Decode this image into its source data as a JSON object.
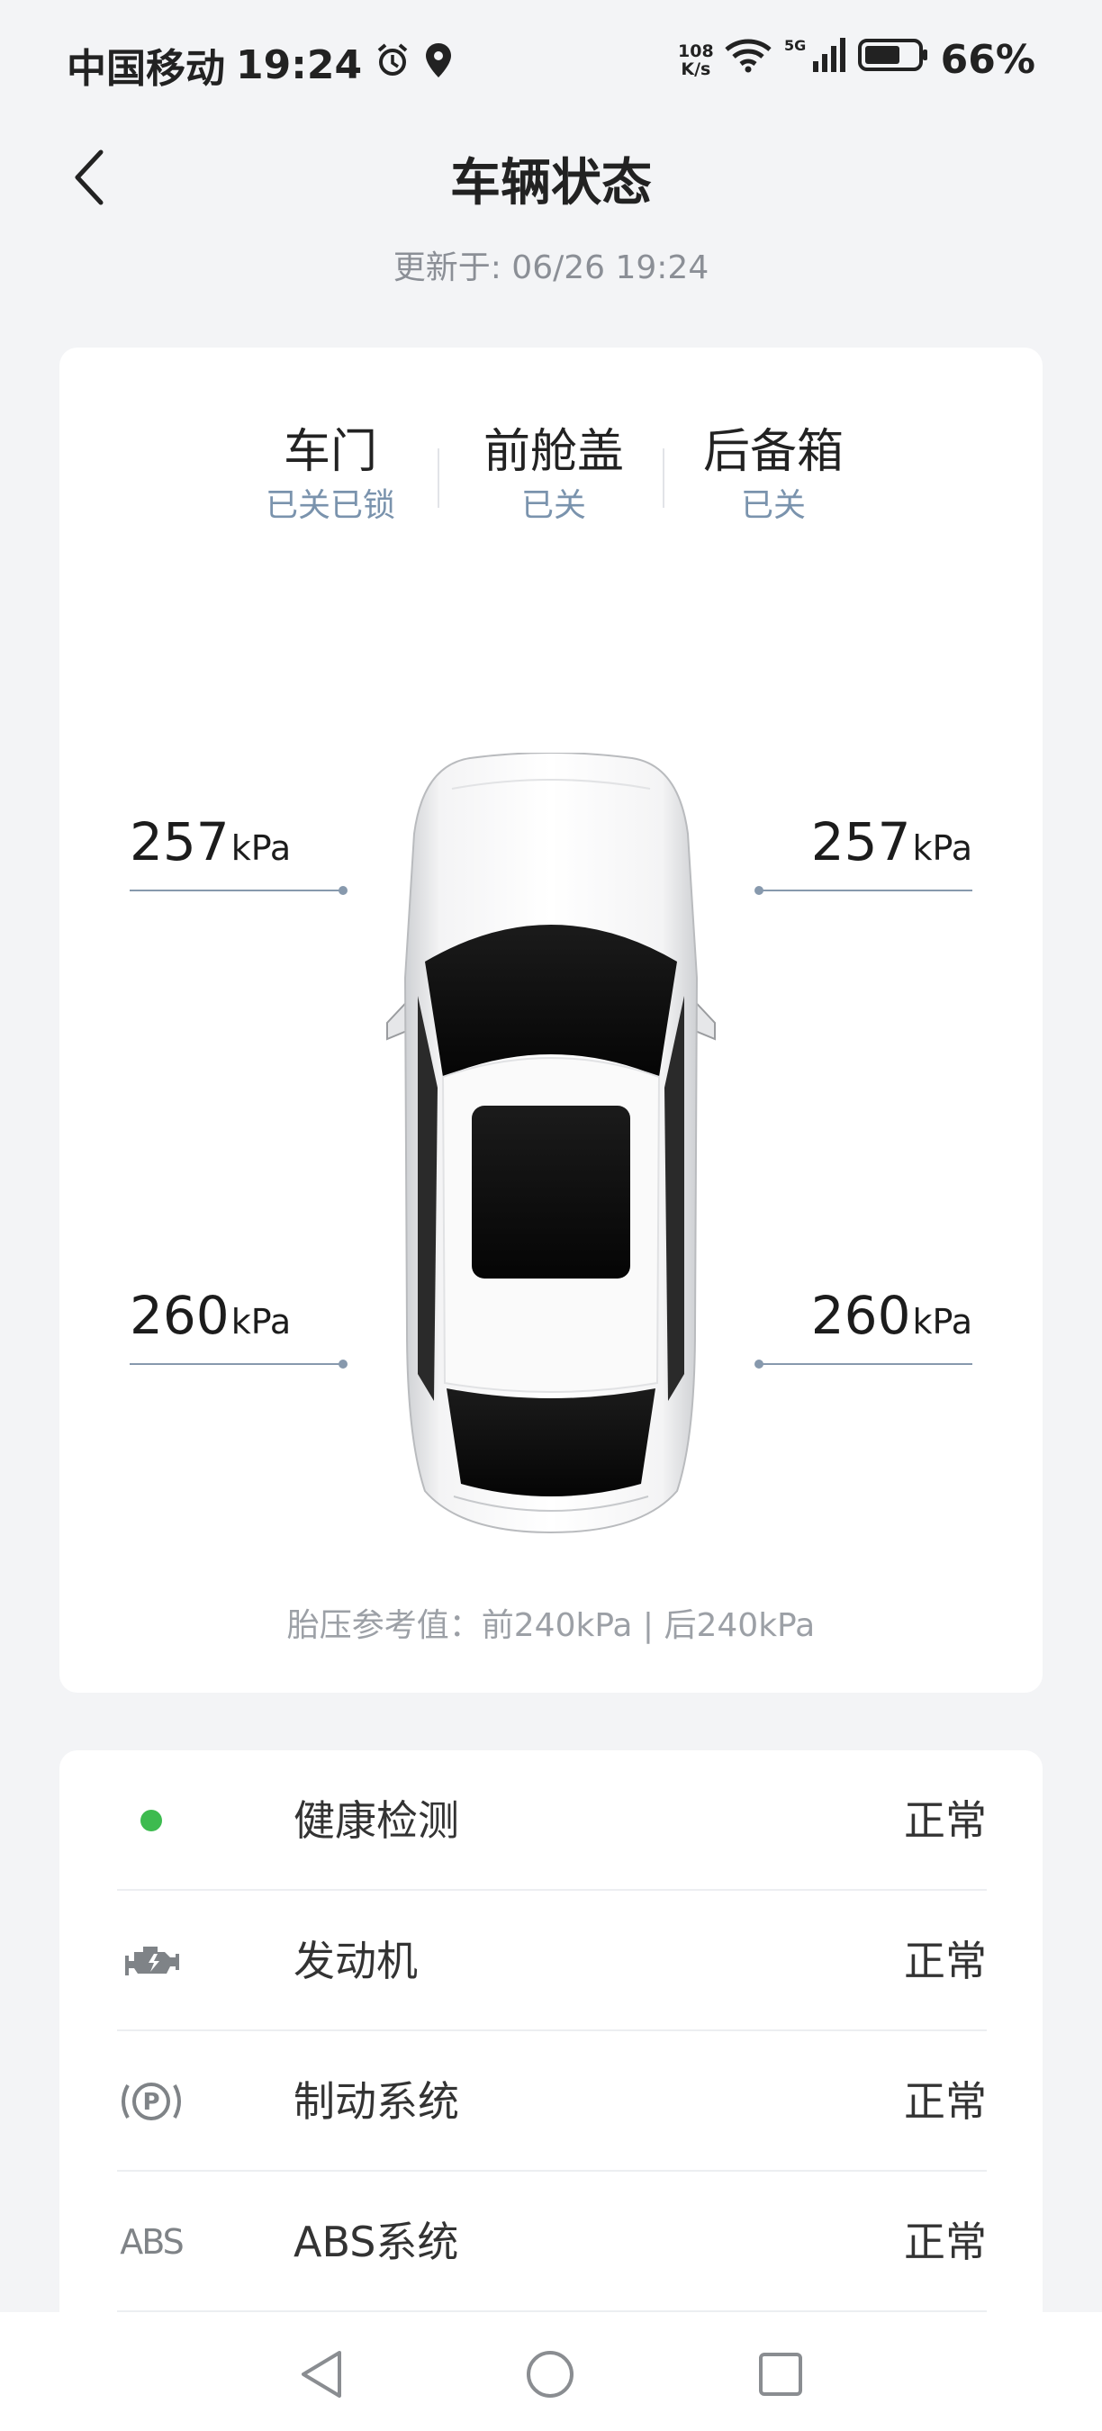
{
  "status_bar": {
    "carrier": "中国移动",
    "time": "19:24",
    "net_speed_value": "108",
    "net_speed_unit": "K/s",
    "battery": "66%",
    "icons": [
      "alarm-icon",
      "location-icon",
      "wifi-icon",
      "5g-signal-icon",
      "battery-icon"
    ]
  },
  "header": {
    "title": "车辆状态",
    "updated": "更新于: 06/26 19:24"
  },
  "vehicle": {
    "states": [
      {
        "label": "车门",
        "value": "已关已锁"
      },
      {
        "label": "前舱盖",
        "value": "已关"
      },
      {
        "label": "后备箱",
        "value": "已关"
      }
    ],
    "tires": {
      "front_left": {
        "value": "257",
        "unit": "kPa"
      },
      "front_right": {
        "value": "257",
        "unit": "kPa"
      },
      "rear_left": {
        "value": "260",
        "unit": "kPa"
      },
      "rear_right": {
        "value": "260",
        "unit": "kPa"
      }
    },
    "reference": "胎压参考值：前240kPa | 后240kPa"
  },
  "checks": [
    {
      "icon": "green-dot-icon",
      "label": "健康检测",
      "value": "正常"
    },
    {
      "icon": "engine-icon",
      "label": "发动机",
      "value": "正常"
    },
    {
      "icon": "parking-brake-icon",
      "label": "制动系统",
      "value": "正常"
    },
    {
      "icon": "abs-icon",
      "icon_text": "ABS",
      "label": "ABS系统",
      "value": "正常"
    }
  ],
  "colors": {
    "accent_text": "#7a93ad",
    "ok_dot": "#3dbb4f",
    "background": "#f3f4f6"
  }
}
